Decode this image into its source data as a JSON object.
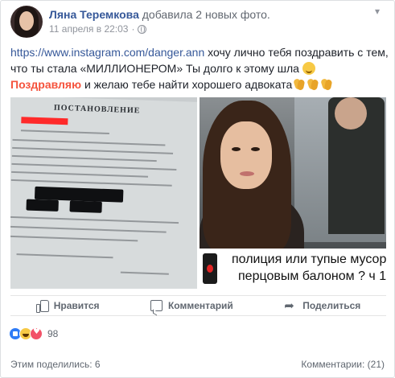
{
  "post": {
    "author": "Ляна Теремкова",
    "action": "добавила 2 новых фото.",
    "timestamp": "11 апреля в 22:03",
    "privacy_icon": "globe-icon",
    "menu_icon": "chevron-down-icon",
    "text": {
      "link": "https://www.instagram.com/danger.ann",
      "part1": " хочу лично тебя поздравить с тем, что ты стала «МИЛЛИОНЕРОМ» Ты долго к этому шла ",
      "highlight": "Поздравляю",
      "part2": " и желаю тебе найти хорошего адвоката"
    }
  },
  "photos": {
    "left": {
      "title": "ПОСТАНОВЛЕНИЕ"
    },
    "right": {
      "caption_line1": "полиция или тупые мусора",
      "caption_line2": "перцовым балоном  ?  ч 1"
    }
  },
  "actions": {
    "like": "Нравится",
    "comment": "Комментарий",
    "share": "Поделиться"
  },
  "reactions": {
    "count": "98"
  },
  "footer": {
    "shares": "Этим поделились: 6",
    "comments": "Комментарии: (21)"
  },
  "colors": {
    "link": "#365899",
    "highlight": "#f5533d",
    "like_blue": "#2e7bf6"
  }
}
